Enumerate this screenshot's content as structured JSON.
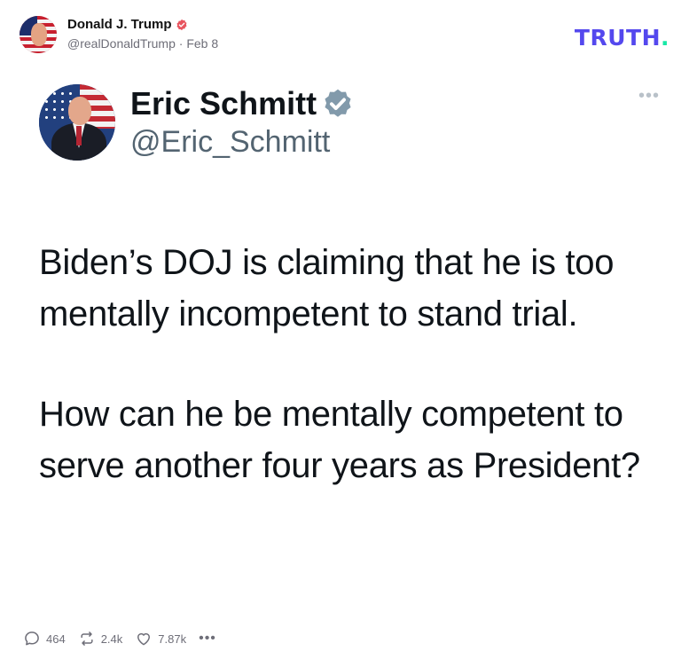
{
  "post": {
    "author_name": "Donald J. Trump",
    "handle": "@realDonaldTrump",
    "separator": "·",
    "date": "Feb 8",
    "verified_icon": "verified-badge-icon",
    "brand_logo": "TRUTH",
    "brand_logo_dot": ".",
    "colors": {
      "brand": "#5448ee",
      "brand_dot": "#17e8a6",
      "verified": "#e8545e"
    }
  },
  "embedded_tweet": {
    "name": "Eric Schmitt",
    "handle": "@Eric_Schmitt",
    "verified_icon": "verified-check-icon",
    "more_icon": "ellipsis-icon",
    "paragraphs": [
      "Biden’s DOJ is claiming that he is too mentally incompetent to stand trial.",
      "How can he be mentally competent to serve another four years as President?"
    ],
    "colors": {
      "verified_badge": "#829aab"
    }
  },
  "actions": {
    "replies": "464",
    "reposts": "2.4k",
    "likes": "7.87k",
    "reply_icon": "reply-bubble-icon",
    "repost_icon": "repost-icon",
    "like_icon": "heart-icon",
    "more_icon": "more-dots-icon"
  }
}
